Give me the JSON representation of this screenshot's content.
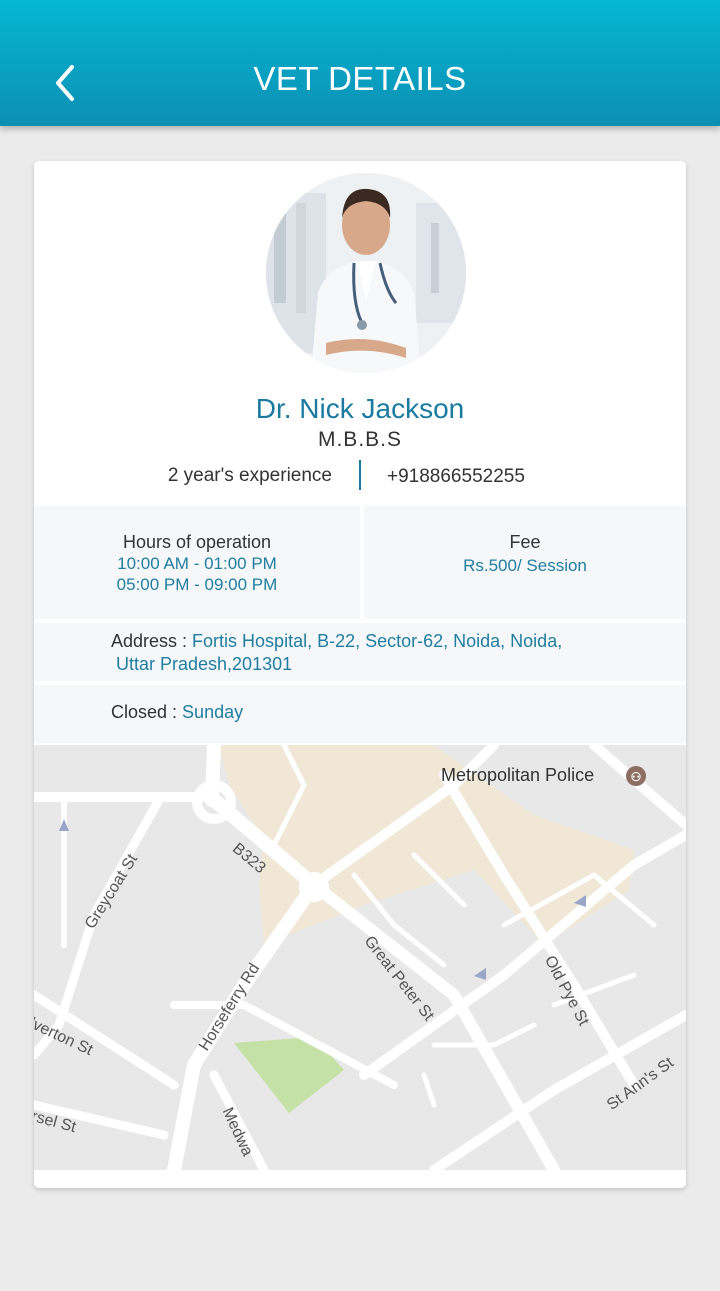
{
  "header": {
    "title": "VET DETAILS",
    "back_icon": "chevron-left-icon",
    "gradient_top": "#04b7d2",
    "gradient_bottom": "#0d8fb4"
  },
  "doctor": {
    "name": "Dr. Nick Jackson",
    "degree": "M.B.B.S",
    "experience": "2 year's experience",
    "phone": "+918866552255"
  },
  "hours": {
    "label": "Hours of operation",
    "slots": [
      "10:00 AM - 01:00 PM",
      "05:00 PM - 09:00 PM"
    ]
  },
  "fee": {
    "label": "Fee",
    "value": "Rs.500/ Session"
  },
  "address": {
    "label": "Address : ",
    "line1": "Fortis Hospital, B-22, Sector-62, Noida, Noida,",
    "line2": "Uttar Pradesh,201301"
  },
  "closed": {
    "label": "Closed : ",
    "value": "Sunday"
  },
  "map": {
    "place": "Metropolitan Police",
    "streets": {
      "b323": "B323",
      "greycoat": "Greycoat St",
      "great_peter": "Great Peter St",
      "old_pye": "Old Pye St",
      "horseferry": "Horseferry Rd",
      "alverton": "lverton St",
      "st_anns": "St Ann's St",
      "marsel": "rsel St",
      "medway": "Medwa"
    }
  },
  "colors": {
    "accent": "#1f7da0",
    "background": "#ebebeb"
  }
}
